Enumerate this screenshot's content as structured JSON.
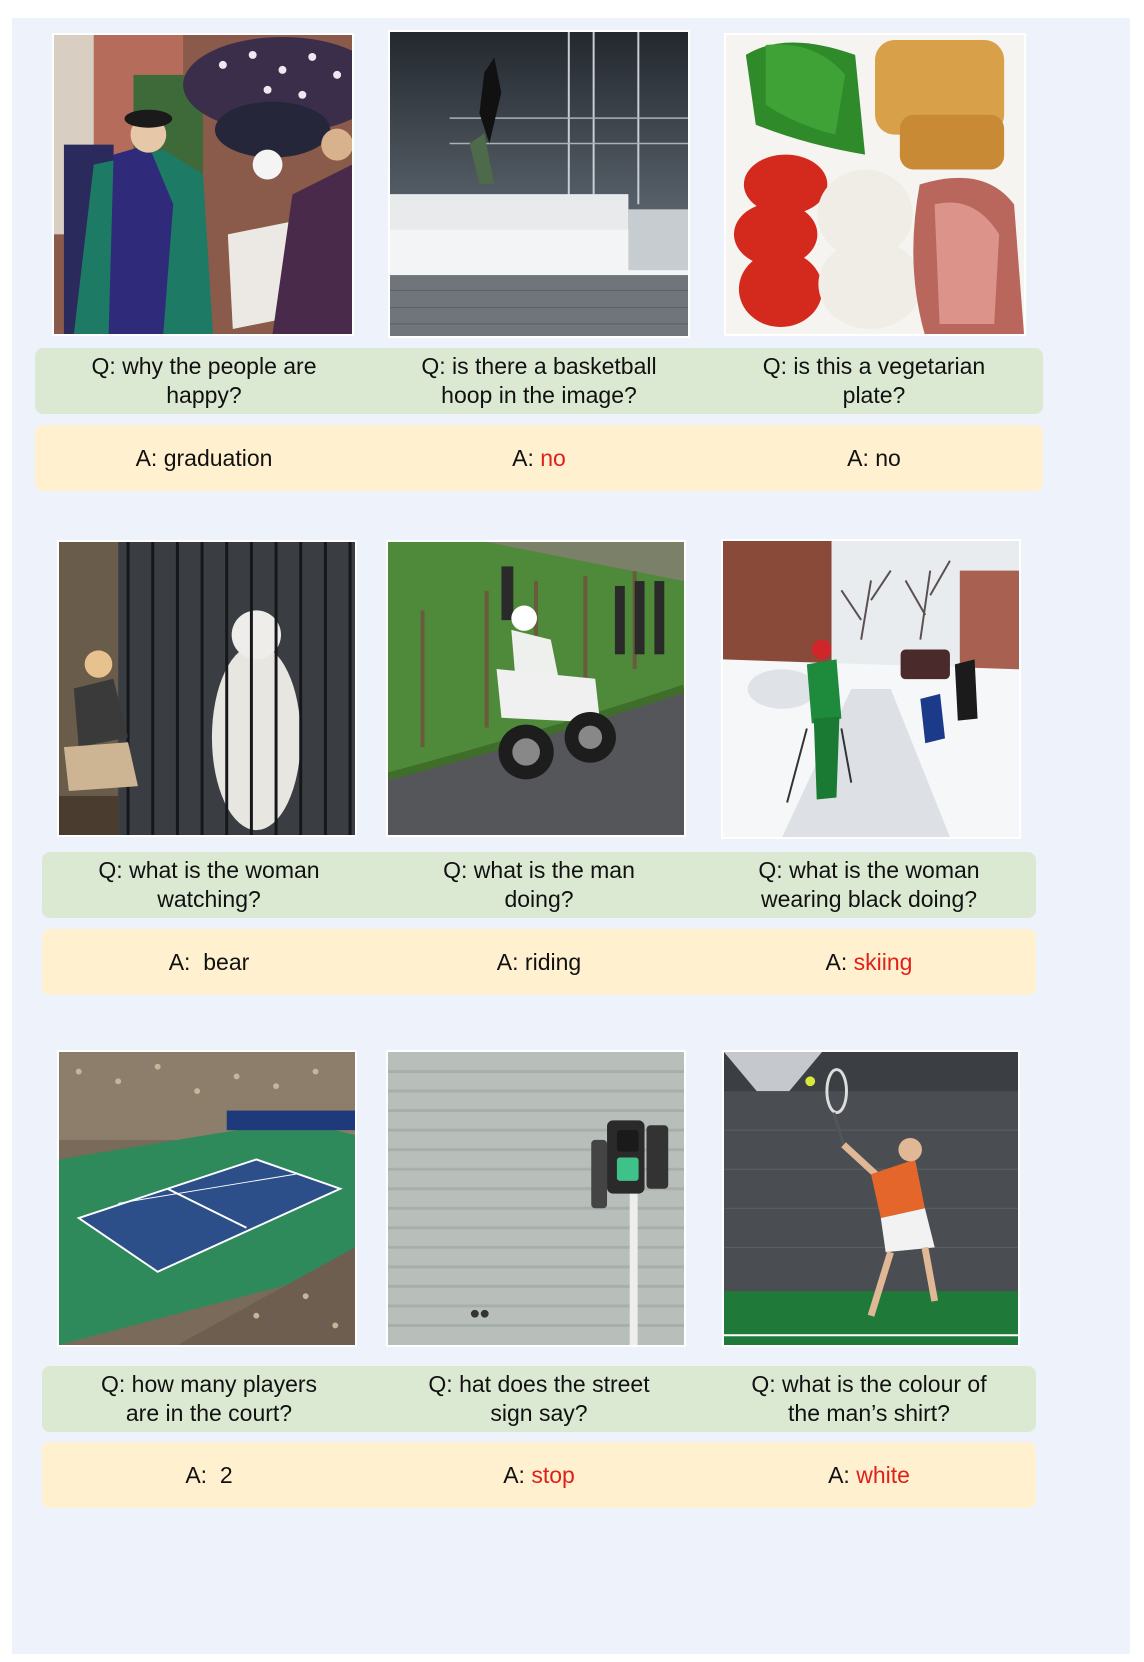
{
  "colors": {
    "panel_bg": "#eef2fa",
    "question_bg": "#dbe9d2",
    "answer_bg": "#fff1cf",
    "wrong_answer": "#e0201b"
  },
  "rows": [
    {
      "cells": [
        {
          "image": "graduation ceremony with people in academic gowns and umbrellas",
          "question": "Q: why the people are\nhappy?",
          "answer_prefix": "A: ",
          "answer": "graduation",
          "answer_wrong": false
        },
        {
          "image": "skateboarder jumping off a white concrete stair structure",
          "question": "Q: is there a basketball\nhoop in the image?",
          "answer_prefix": "A: ",
          "answer": "no",
          "answer_wrong": true
        },
        {
          "image": "plate with lettuce, tomato slices, mozzarella, ham and bread",
          "question": "Q: is this a vegetarian\nplate?",
          "answer_prefix": "A: ",
          "answer": "no",
          "answer_wrong": false
        }
      ]
    },
    {
      "cells": [
        {
          "image": "woman crouching beside a cage with a white bear",
          "question": "Q: what is the woman\nwatching?",
          "answer_prefix": "A:  ",
          "answer": "bear",
          "answer_wrong": false
        },
        {
          "image": "man riding a motorcycle on a curved road next to grass",
          "question": "Q: what is the man\ndoing?",
          "answer_prefix": "A: ",
          "answer": "riding",
          "answer_wrong": false
        },
        {
          "image": "people on skis on a snowy city street",
          "question": "Q: what is the woman\nwearing black doing?",
          "answer_prefix": "A: ",
          "answer": "skiing",
          "answer_wrong": true
        }
      ]
    },
    {
      "cells": [
        {
          "image": "aerial view of a tennis court in a crowded stadium",
          "question": "Q: how many players\nare in the court?",
          "answer_prefix": "A:  ",
          "answer": "2",
          "answer_wrong": false
        },
        {
          "image": "pedestrian traffic light in front of a grey wall",
          "question": "Q: hat does the street\nsign say?",
          "answer_prefix": "A: ",
          "answer": "stop",
          "answer_wrong": true
        },
        {
          "image": "man in orange shirt serving a tennis ball",
          "question": "Q: what is the colour of\nthe man’s shirt?",
          "answer_prefix": "A: ",
          "answer": "white",
          "answer_wrong": true
        }
      ]
    }
  ]
}
